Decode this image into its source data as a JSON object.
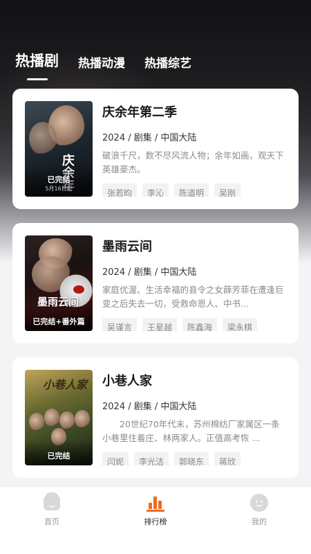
{
  "tabs": [
    {
      "label": "热播剧",
      "active": true
    },
    {
      "label": "热播动漫",
      "active": false
    },
    {
      "label": "热播综艺",
      "active": false
    }
  ],
  "shows": [
    {
      "title": "庆余年第二季",
      "meta": "2024 / 剧集 / 中国大陆",
      "description": "破浪千尺，数不尽风流人物；余年如画，观天下英雄豪杰。",
      "cast": [
        "张若昀",
        "李沁",
        "陈道明",
        "吴刚"
      ],
      "poster": {
        "title_art": "庆余年",
        "status": "已完结",
        "overlay_text": "5月16日起"
      }
    },
    {
      "title": "墨雨云间",
      "meta": "2024 / 剧集 / 中国大陆",
      "description": "家庭优渥、生活幸福的县令之女薛芳菲在遭逢巨变之后失去一切，受救命恩人、中书...",
      "cast": [
        "吴谨言",
        "王星越",
        "陈鑫海",
        "梁永棋"
      ],
      "poster": {
        "title_art": "墨雨云间",
        "status": "已完结+番外篇"
      }
    },
    {
      "title": "小巷人家",
      "meta": "2024 / 剧集 / 中国大陆",
      "description": "20世纪70年代末，苏州棉纺厂家属区一条小巷里住着庄、林两家人。正值高考恢 ...",
      "cast": [
        "闫妮",
        "李光洁",
        "郭晓东",
        "蒋欣"
      ],
      "poster": {
        "title_art": "小巷人家",
        "status": "已完结"
      }
    }
  ],
  "nav": [
    {
      "label": "首页",
      "icon": "home-icon",
      "active": false
    },
    {
      "label": "排行榜",
      "icon": "ranking-icon",
      "active": true
    },
    {
      "label": "我的",
      "icon": "profile-icon",
      "active": false
    }
  ],
  "colors": {
    "accent": "#f06a1d"
  }
}
